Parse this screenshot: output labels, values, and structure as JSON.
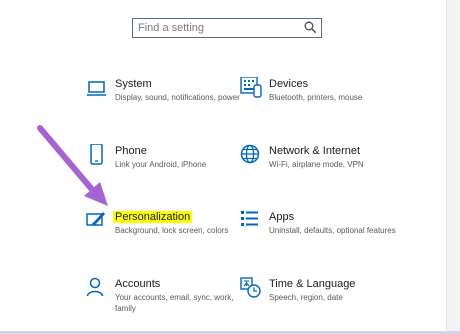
{
  "search": {
    "placeholder": "Find a setting"
  },
  "tiles": [
    {
      "title": "System",
      "desc": "Display, sound, notifications, power",
      "icon": "laptop-icon"
    },
    {
      "title": "Devices",
      "desc": "Bluetooth, printers, mouse",
      "icon": "keyboard-icon"
    },
    {
      "title": "Phone",
      "desc": "Link your Android, iPhone",
      "icon": "phone-icon"
    },
    {
      "title": "Network & Internet",
      "desc": "Wi-Fi, airplane mode, VPN",
      "icon": "globe-icon"
    },
    {
      "title": "Personalization",
      "desc": "Background, lock screen, colors",
      "icon": "paintbrush-icon"
    },
    {
      "title": "Apps",
      "desc": "Uninstall, defaults, optional features",
      "icon": "apps-list-icon"
    },
    {
      "title": "Accounts",
      "desc": "Your accounts, email, sync, work, family",
      "icon": "person-icon"
    },
    {
      "title": "Time & Language",
      "desc": "Speech, region, date",
      "icon": "time-language-icon"
    }
  ],
  "colors": {
    "accent": "#0067c0",
    "highlight": "#fbff00",
    "arrow": "#a564d6"
  }
}
